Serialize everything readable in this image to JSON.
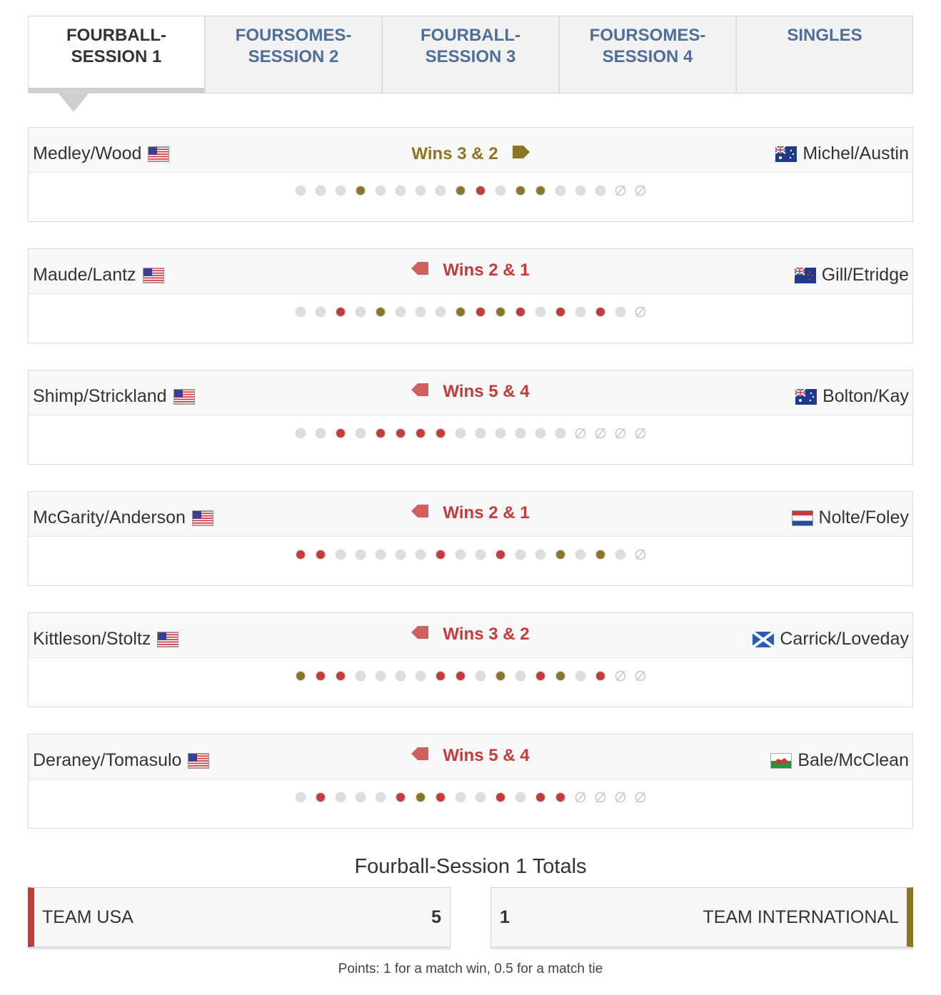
{
  "tabs": [
    {
      "label": "FOURBALL-\nSESSION 1",
      "active": true
    },
    {
      "label": "FOURSOMES-\nSESSION 2",
      "active": false
    },
    {
      "label": "FOURBALL-\nSESSION 3",
      "active": false
    },
    {
      "label": "FOURSOMES-\nSESSION 4",
      "active": false
    },
    {
      "label": "SINGLES",
      "active": false
    }
  ],
  "colors": {
    "usa": "#c53a3a",
    "international": "#8a7624",
    "neutral": "#dddddd",
    "unplayed": "#c8c8c8"
  },
  "matches": [
    {
      "usa_team": "Medley/Wood",
      "usa_flag": "usa-flag",
      "intl_team": "Michel/Austin",
      "intl_flag": "australia-flag",
      "result": "Wins 3 & 2",
      "winner": "intl",
      "holes": [
        "n",
        "n",
        "n",
        "i",
        "n",
        "n",
        "n",
        "n",
        "i",
        "u",
        "n",
        "i",
        "i",
        "n",
        "n",
        "n",
        "x",
        "x"
      ]
    },
    {
      "usa_team": "Maude/Lantz",
      "usa_flag": "usa-flag",
      "intl_team": "Gill/Etridge",
      "intl_flag": "new-zealand-flag",
      "result": "Wins 2 & 1",
      "winner": "usa",
      "holes": [
        "n",
        "n",
        "u",
        "n",
        "i",
        "n",
        "n",
        "n",
        "i",
        "u",
        "i",
        "u",
        "n",
        "u",
        "n",
        "u",
        "n",
        "x"
      ]
    },
    {
      "usa_team": "Shimp/Strickland",
      "usa_flag": "usa-flag",
      "intl_team": "Bolton/Kay",
      "intl_flag": "australia-flag",
      "result": "Wins 5 & 4",
      "winner": "usa",
      "holes": [
        "n",
        "n",
        "u",
        "n",
        "u",
        "u",
        "u",
        "u",
        "n",
        "n",
        "n",
        "n",
        "n",
        "n",
        "x",
        "x",
        "x",
        "x"
      ]
    },
    {
      "usa_team": "McGarity/Anderson",
      "usa_flag": "usa-flag",
      "intl_team": "Nolte/Foley",
      "intl_flag": "netherlands-flag",
      "result": "Wins 2 & 1",
      "winner": "usa",
      "holes": [
        "u",
        "u",
        "n",
        "n",
        "n",
        "n",
        "n",
        "u",
        "n",
        "n",
        "u",
        "n",
        "n",
        "i",
        "n",
        "i",
        "n",
        "x"
      ]
    },
    {
      "usa_team": "Kittleson/Stoltz",
      "usa_flag": "usa-flag",
      "intl_team": "Carrick/Loveday",
      "intl_flag": "scotland-flag",
      "result": "Wins 3 & 2",
      "winner": "usa",
      "holes": [
        "i",
        "u",
        "u",
        "n",
        "n",
        "n",
        "n",
        "u",
        "u",
        "n",
        "i",
        "n",
        "u",
        "i",
        "n",
        "u",
        "x",
        "x"
      ]
    },
    {
      "usa_team": "Deraney/Tomasulo",
      "usa_flag": "usa-flag",
      "intl_team": "Bale/McClean",
      "intl_flag": "wales-flag",
      "result": "Wins 5 & 4",
      "winner": "usa",
      "holes": [
        "n",
        "u",
        "n",
        "n",
        "n",
        "u",
        "i",
        "u",
        "n",
        "n",
        "u",
        "n",
        "u",
        "u",
        "x",
        "x",
        "x",
        "x"
      ]
    }
  ],
  "totals": {
    "title": "Fourball-Session 1 Totals",
    "usa_label": "TEAM USA",
    "usa_score": "5",
    "intl_score": "1",
    "intl_label": "TEAM INTERNATIONAL",
    "note": "Points: 1 for a match win, 0.5 for a match tie"
  }
}
